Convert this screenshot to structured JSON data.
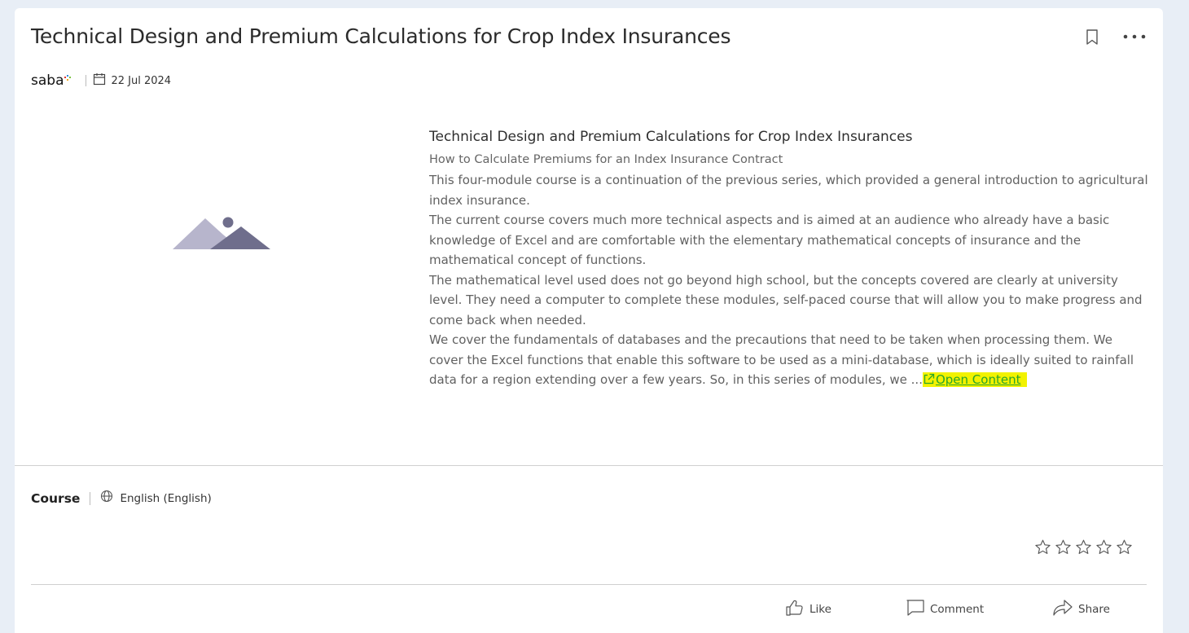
{
  "course": {
    "title": "Technical Design and Premium Calculations for Crop Index Insurances",
    "provider_logo_text": "saba",
    "date": "22 Jul 2024",
    "type": "Course",
    "language": "English (English)"
  },
  "description": {
    "title": "Technical Design and Premium Calculations for Crop Index Insurances",
    "subtitle": "How to Calculate Premiums for an Index Insurance Contract",
    "paragraphs": [
      "This four-module course is a continuation of the previous series, which provided a general introduction to agricultural index insurance.",
      "The current course covers much more technical aspects and is aimed at an audience who already have a basic knowledge of Excel and are comfortable with the elementary mathematical concepts of insurance and the mathematical concept of functions.",
      "The mathematical level used does not go beyond high school, but the concepts covered are clearly at university level. They need a computer to complete these modules, self-paced course that will allow you to make progress and come back when needed."
    ],
    "last_paragraph": "We cover the fundamentals of databases and the precautions that need to be taken when processing them. We cover the Excel functions that enable this software to be used as a mini-database, which is ideally suited to rainfall data for a region extending over a few years. So, in this series of modules, we ...",
    "open_content_label": "Open Content"
  },
  "rating": {
    "stars_total": 5,
    "stars_filled": 0
  },
  "actions": {
    "like_label": "Like",
    "comment_label": "Comment",
    "share_label": "Share"
  },
  "colors": {
    "page_bg": "#e8eef6",
    "card_bg": "#ffffff",
    "highlight": "#f2f200",
    "link": "#2aa52a"
  },
  "icons": [
    "bookmark-icon",
    "more-icon",
    "calendar-icon",
    "placeholder-image-icon",
    "external-link-icon",
    "globe-icon",
    "star-icon",
    "like-icon",
    "comment-icon",
    "share-icon"
  ]
}
